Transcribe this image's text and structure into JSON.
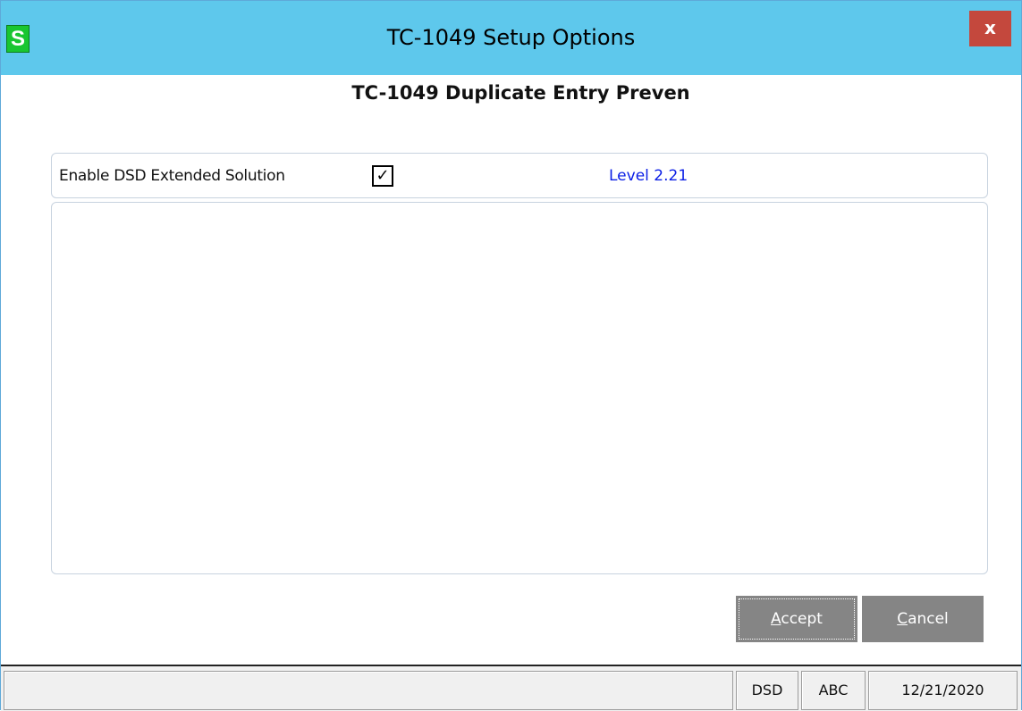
{
  "window": {
    "title": "TC-1049 Setup Options",
    "app_icon_letter": "S",
    "close_label": "x",
    "accent_color": "#5ec8ec",
    "close_color": "#c4483d"
  },
  "main": {
    "heading": "TC-1049 Duplicate Entry Preven",
    "option_label": "Enable DSD Extended Solution",
    "option_checked": true,
    "checkbox_glyph": "✓",
    "level_text": "Level  2.21",
    "level_color": "#0a1ee6"
  },
  "buttons": {
    "accept_mnemonic": "A",
    "accept_rest": "ccept",
    "cancel_mnemonic": "C",
    "cancel_rest": "ancel"
  },
  "statusbar": {
    "message": "",
    "company_code": "DSD",
    "company": "ABC",
    "date": "12/21/2020"
  },
  "icons": {
    "app_icon": "sage-s-icon",
    "close": "close-icon",
    "check": "checkmark-icon"
  }
}
